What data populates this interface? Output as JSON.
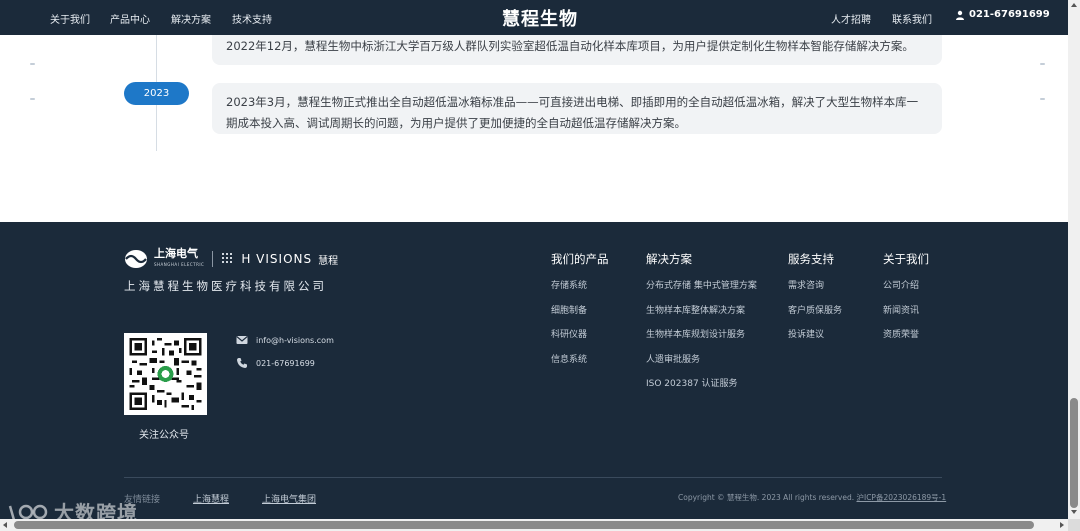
{
  "nav": {
    "items": [
      "关于我们",
      "产品中心",
      "解决方案",
      "技术支持"
    ],
    "logo": "慧程生物",
    "right_items": [
      "人才招聘",
      "联系我们"
    ],
    "phone": "021-67691699",
    "phone_icon": "user-phone-icon"
  },
  "timeline": {
    "entries": [
      {
        "year": "",
        "text": "2022年12月，慧程生物中标浙江大学百万级人群队列实验室超低温自动化样本库项目，为用户提供定制化生物样本智能存储解决方案。"
      },
      {
        "year": "2023",
        "text_line1": "2023年3月，慧程生物正式推出全自动超低温冰箱标准品——可直接进出电梯、即插即用的全自动超低温冰箱，解决了大型生物样本库一",
        "text_line2": "期成本投入高、调试周期长的问题，为用户提供了更加便捷的全自动超低温存储解决方案。"
      }
    ],
    "accent_color": "#1e78c8"
  },
  "footer": {
    "brand": {
      "shanghai_electric": "上海电气",
      "shanghai_electric_en": "SHANGHAI ELECTRIC",
      "hvisions": "H VISIONS",
      "hvisions_cn": "慧程"
    },
    "company_name": "上海慧程生物医疗科技有限公司",
    "qr_caption": "关注公众号",
    "email": "info@h-visions.com",
    "phone": "021-67691699",
    "columns": [
      {
        "title": "我们的产品",
        "links": [
          "存储系统",
          "细胞制备",
          "科研仪器",
          "信息系统"
        ]
      },
      {
        "title": "解决方案",
        "links": [
          "分布式存储 集中式管理方案",
          "生物样本库整体解决方案",
          "生物样本库规划设计服务",
          "人遗审批服务",
          "ISO 202387 认证服务"
        ]
      },
      {
        "title": "服务支持",
        "links": [
          "需求咨询",
          "客户质保服务",
          "投诉建议"
        ]
      },
      {
        "title": "关于我们",
        "links": [
          "公司介绍",
          "新闻资讯",
          "资质荣誉"
        ]
      }
    ],
    "friend_label": "友情链接",
    "friend_links": [
      "上海慧程",
      "上海电气集团"
    ],
    "copyright": "Copyright © 慧程生物. 2023 All rights reserved.",
    "icp": "沪ICP备2023026189号-1",
    "background_color": "#1b2a3a"
  },
  "watermark": "大数跨境"
}
